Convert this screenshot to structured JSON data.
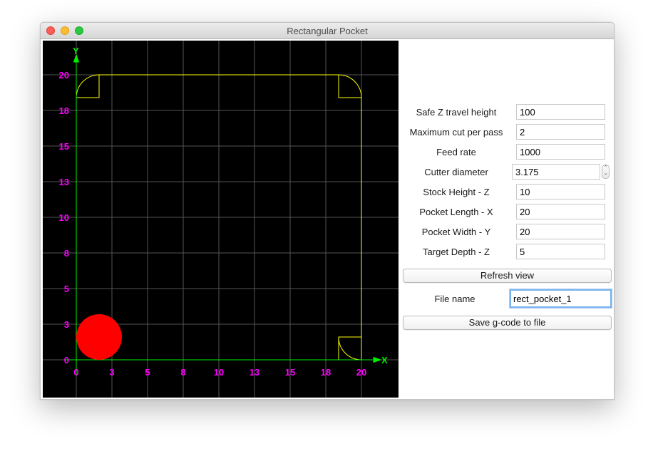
{
  "window": {
    "title": "Rectangular Pocket"
  },
  "canvas": {
    "x_axis_label": "X",
    "y_axis_label": "Y",
    "x_ticks": [
      "0",
      "3",
      "5",
      "8",
      "10",
      "13",
      "15",
      "18",
      "20"
    ],
    "y_ticks": [
      "0",
      "3",
      "5",
      "8",
      "10",
      "13",
      "15",
      "18",
      "20"
    ],
    "colors": {
      "background": "#000000",
      "grid": "#555555",
      "pocket": "#ffff00",
      "axes": "#00ee00",
      "ticks": "#ff00ff",
      "cutter": "#ff0000"
    }
  },
  "form": {
    "fields": [
      {
        "label": "Safe Z travel height",
        "value": "100"
      },
      {
        "label": "Maximum cut per pass",
        "value": "2"
      },
      {
        "label": "Feed rate",
        "value": "1000"
      },
      {
        "label": "Cutter diameter",
        "value": "3.175"
      },
      {
        "label": "Stock Height - Z",
        "value": "10"
      },
      {
        "label": "Pocket Length - X",
        "value": "20"
      },
      {
        "label": "Pocket Width - Y",
        "value": "20"
      },
      {
        "label": "Target Depth - Z",
        "value": "5"
      }
    ],
    "refresh_label": "Refresh view",
    "file_name_label": "File name",
    "file_name_value": "rect_pocket_1",
    "save_label": "Save g-code to file"
  }
}
